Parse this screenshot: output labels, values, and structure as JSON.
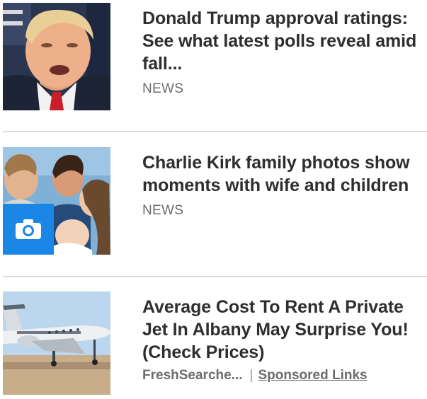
{
  "articles": [
    {
      "headline": "Donald Trump approval ratings: See what latest polls reveal amid fall...",
      "category": "NEWS",
      "thumbnail": "portrait-photo",
      "has_gallery_badge": false
    },
    {
      "headline": "Charlie Kirk family photos show moments with wife and children",
      "category": "NEWS",
      "thumbnail": "family-photo",
      "has_gallery_badge": true,
      "badge_icon": "camera-icon"
    },
    {
      "headline": "Average Cost To Rent A Private Jet In Albany May Surprise You! (Check Prices)",
      "sponsor": "FreshSearche...",
      "separator": "|",
      "sponsored_label": "Sponsored Links",
      "thumbnail": "private-jet-photo"
    }
  ],
  "colors": {
    "headline": "#2e2e2e",
    "meta": "#6c6c6c",
    "divider": "#dcdcdc",
    "gallery_badge": "#1a87e6"
  }
}
